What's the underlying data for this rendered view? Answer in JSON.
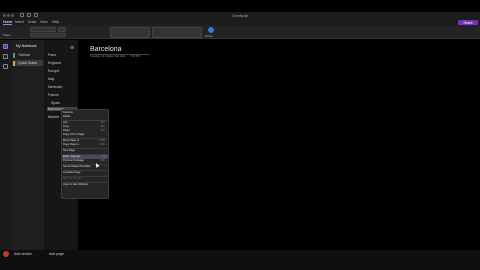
{
  "app": {
    "title": "OneNote"
  },
  "ribbon": {
    "tabs": [
      "Home",
      "Insert",
      "Draw",
      "View",
      "Help"
    ],
    "active_tab": "Home",
    "paste_label": "Paste",
    "dictate_label": "Dictate",
    "share_label": "Share"
  },
  "notebook": {
    "name": "My Notebook"
  },
  "sections": [
    {
      "label": "Tutorial",
      "color": "#3aa76d"
    },
    {
      "label": "Quick Notes",
      "color": "#e8a33d",
      "selected": true
    }
  ],
  "pages": [
    {
      "label": "Paris"
    },
    {
      "label": "England"
    },
    {
      "label": "Europe"
    },
    {
      "label": "Italy"
    },
    {
      "label": "Denmark"
    },
    {
      "label": "France"
    },
    {
      "label": "Spain"
    },
    {
      "label": "Barcelona",
      "selected": true
    },
    {
      "label": "Madrid"
    }
  ],
  "page": {
    "title": "Barcelona",
    "date": "Tuesday, 14 October Dec 2021",
    "time": "7:30 PM"
  },
  "context_menu": [
    {
      "label": "Rename"
    },
    {
      "label": "Delete"
    },
    {
      "sep": true
    },
    {
      "label": "Cut",
      "shortcut": "⌘X"
    },
    {
      "label": "Copy",
      "shortcut": "⌘C"
    },
    {
      "label": "Paste",
      "shortcut": "⌘V"
    },
    {
      "label": "Copy Link to Page"
    },
    {
      "sep": true
    },
    {
      "label": "Move Page to...",
      "shortcut": "⌥⌘M"
    },
    {
      "label": "Copy Page to...",
      "shortcut": "⇧⌘C"
    },
    {
      "sep": true
    },
    {
      "label": "New Page"
    },
    {
      "sep": true
    },
    {
      "label": "Make Subpage",
      "shortcut": "⌥⌘]",
      "highlighted": true
    },
    {
      "label": "Promote Subpage",
      "shortcut": "⌥⌘["
    },
    {
      "sep": true
    },
    {
      "label": "Set as Default Template"
    },
    {
      "sep": true
    },
    {
      "label": "Translate Page"
    },
    {
      "sep": true
    },
    {
      "label": "Mark as Unread",
      "disabled": true
    },
    {
      "sep": true
    },
    {
      "label": "Open in New Window"
    }
  ],
  "footer": {
    "add_section": "Add section",
    "add_page": "Add page"
  }
}
